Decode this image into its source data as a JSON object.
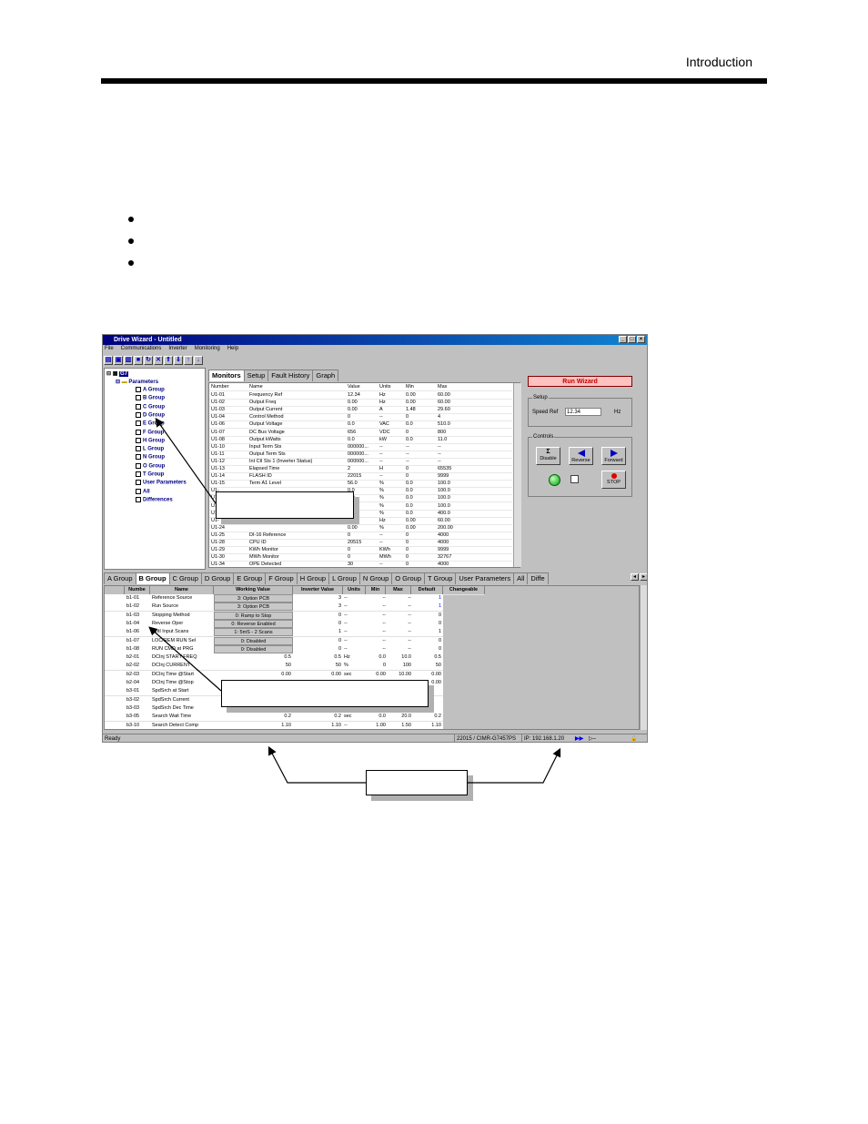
{
  "header": {
    "title": "Introduction"
  },
  "window": {
    "title": "Drive Wizard - Untitled",
    "menu": [
      "File",
      "Communications",
      "Inverter",
      "Monitoring",
      "Help"
    ]
  },
  "tree": {
    "root": "G7",
    "parameters": "Parameters",
    "items": [
      "A Group",
      "B Group",
      "C Group",
      "D Group",
      "E Group",
      "F Group",
      "H Group",
      "L Group",
      "N Group",
      "O Group",
      "T Group",
      "User Parameters",
      "All",
      "Differences"
    ]
  },
  "top_tabs": [
    "Monitors",
    "Setup",
    "Fault History",
    "Graph"
  ],
  "monitor_headers": [
    "Number",
    "Name",
    "Value",
    "Units",
    "Min",
    "Max"
  ],
  "monitor_rows": [
    [
      "U1-01",
      "Frequency Ref",
      "12.34",
      "Hz",
      "0.00",
      "60.00"
    ],
    [
      "U1-02",
      "Output Freq",
      "0.00",
      "Hz",
      "0.00",
      "60.00"
    ],
    [
      "U1-03",
      "Output Current",
      "0.00",
      "A",
      "1.48",
      "29.60"
    ],
    [
      "U1-04",
      "Control Method",
      "0",
      "--",
      "0",
      "4"
    ],
    [
      "U1-06",
      "Output Voltage",
      "0.0",
      "VAC",
      "0.0",
      "510.0"
    ],
    [
      "U1-07",
      "DC Bus Voltage",
      "656",
      "VDC",
      "0",
      "800"
    ],
    [
      "U1-08",
      "Output kWatts",
      "0.0",
      "kW",
      "0.0",
      "11.0"
    ],
    [
      "U1-10",
      "Input Term Sts",
      "000000...",
      "--",
      "--",
      "--"
    ],
    [
      "U1-11",
      "Output Term Sts",
      "000000...",
      "--",
      "--",
      "--"
    ],
    [
      "U1-12",
      "Int Ctl Sts 1 (Inverter Status)",
      "000000...",
      "--",
      "--",
      "--"
    ],
    [
      "U1-13",
      "Elapsed Time",
      "2",
      "H",
      "0",
      "65535"
    ],
    [
      "U1-14",
      "FLASH ID",
      "22015",
      "--",
      "0",
      "9999"
    ],
    [
      "U1-15",
      "Term A1 Level",
      "56.0",
      "%",
      "0.0",
      "100.0"
    ],
    [
      "U1-",
      "",
      "0.0",
      "%",
      "0.0",
      "100.0"
    ],
    [
      "U1-",
      "",
      "0.0",
      "%",
      "0.0",
      "100.0"
    ],
    [
      "U1-",
      "",
      "0.0",
      "%",
      "0.0",
      "100.0"
    ],
    [
      "U1-",
      "",
      "0.0",
      "%",
      "0.0",
      "400.0"
    ],
    [
      "U1-",
      "",
      "0.0",
      "Hz",
      "0.00",
      "60.00"
    ],
    [
      "U1-24",
      "",
      "0.00",
      "%",
      "0.00",
      "200.00"
    ],
    [
      "U1-25",
      "DI-16 Reference",
      "0",
      "--",
      "0",
      "4000"
    ],
    [
      "U1-28",
      "CPU ID",
      "20515",
      "--",
      "0",
      "4000"
    ],
    [
      "U1-29",
      "KWh Monitor",
      "0",
      "KWh",
      "0",
      "9999"
    ],
    [
      "U1-30",
      "MWh Monitor",
      "0",
      "MWh",
      "0",
      "32767"
    ],
    [
      "U1-34",
      "OPE Detected",
      "30",
      "--",
      "0",
      "4000"
    ]
  ],
  "right_panel": {
    "run_wizard": "Run Wizard",
    "setup_label": "Setup",
    "speed_ref_label": "Speed Ref",
    "speed_ref_value": "12.34",
    "speed_ref_unit": "Hz",
    "controls_label": "Controls",
    "disable": "Disable",
    "reverse": "Reverse",
    "forward": "Forward",
    "stop": "STOP"
  },
  "group_tabs": [
    "A Group",
    "B Group",
    "C Group",
    "D Group",
    "E Group",
    "F Group",
    "H Group",
    "L Group",
    "N Group",
    "O Group",
    "T Group",
    "User Parameters",
    "All",
    "Diffe"
  ],
  "param_headers": [
    "Numbe",
    "Name",
    "Working Value",
    "Inverter Value",
    "Units",
    "Min",
    "Max",
    "Default",
    "Changeable"
  ],
  "param_rows": [
    [
      "b1-01",
      "Reference Source",
      "3: Option PCB",
      "3",
      "--",
      "--",
      "--",
      "1"
    ],
    [
      "b1-02",
      "Run Source",
      "3: Option PCB",
      "3",
      "--",
      "--",
      "--",
      "1"
    ],
    [
      "b1-03",
      "Stopping Method",
      "0: Ramp to Stop",
      "0",
      "--",
      "--",
      "--",
      "0"
    ],
    [
      "b1-04",
      "Reverse Oper",
      "0: Reverse Enabled",
      "0",
      "--",
      "--",
      "--",
      "0"
    ],
    [
      "b1-06",
      "Cntl Input Scans",
      "1: 5mS - 2 Scans",
      "1",
      "--",
      "--",
      "--",
      "1"
    ],
    [
      "b1-07",
      "LOC/REM RUN Sel",
      "0: Disabled",
      "0",
      "--",
      "--",
      "--",
      "0"
    ],
    [
      "b1-08",
      "RUN CMD at PRG",
      "0: Disabled",
      "0",
      "--",
      "--",
      "--",
      "0"
    ],
    [
      "b2-01",
      "DCInj START FREQ",
      "0.5",
      "0.5",
      "Hz",
      "0.0",
      "10.0",
      "0.5"
    ],
    [
      "b2-02",
      "DCInj CURRENT",
      "50",
      "50",
      "%",
      "0",
      "100",
      "50"
    ],
    [
      "b2-03",
      "DCInj Time @Start",
      "0.00",
      "0.00",
      "sec",
      "0.00",
      "10.00",
      "0.00"
    ],
    [
      "b2-04",
      "DCInj Time @Stop",
      "",
      "",
      "",
      "",
      "",
      "0.00"
    ],
    [
      "b3-01",
      "SpdSrch at Start",
      "2",
      "",
      "",
      "",
      "",
      ""
    ],
    [
      "b3-02",
      "SpdSrch Current",
      "",
      "",
      "",
      "",
      "",
      ""
    ],
    [
      "b3-03",
      "SpdSrch Dec Time",
      "",
      "",
      "",
      "",
      "",
      ""
    ],
    [
      "b3-05",
      "Search Wait Time",
      "0.2",
      "0.2",
      "sec",
      "0.0",
      "20.0",
      "0.2"
    ],
    [
      "b3-10",
      "Search Detect Comp",
      "1.10",
      "1.10",
      "--",
      "1.00",
      "1.50",
      "1.10"
    ]
  ],
  "status": {
    "left": "Ready",
    "drive": "22015 / CIMR-G7457PS",
    "ip": "IP: 192.168.1.20"
  }
}
